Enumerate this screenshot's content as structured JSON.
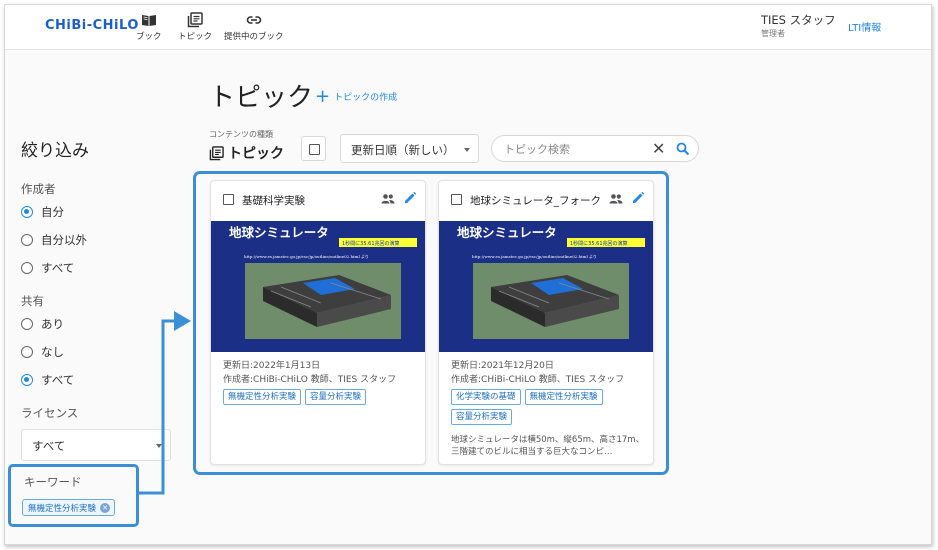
{
  "app": {
    "logo": "CHiBi-CHiLO",
    "nav": [
      {
        "label": "ブック",
        "icon": "book-icon"
      },
      {
        "label": "トピック",
        "icon": "topic-icon"
      },
      {
        "label": "提供中のブック",
        "icon": "link-icon"
      }
    ],
    "user": {
      "name": "TIES スタッフ",
      "role": "管理者"
    },
    "lti_link": "LTI情報"
  },
  "page": {
    "title": "トピック",
    "create_label": "トピックの作成"
  },
  "filter": {
    "title": "絞り込み",
    "author": {
      "label": "作成者",
      "options": [
        "自分",
        "自分以外",
        "すべて"
      ],
      "selected": "自分"
    },
    "share": {
      "label": "共有",
      "options": [
        "あり",
        "なし",
        "すべて"
      ],
      "selected": "すべて"
    },
    "license": {
      "label": "ライセンス",
      "value": "すべて"
    },
    "keyword": {
      "label": "キーワード",
      "chip": "無機定性分析実験"
    }
  },
  "toolbar": {
    "content_type_label": "コンテンツの種類",
    "content_type_value": "トピック",
    "sort_value": "更新日順（新しい）",
    "search_placeholder": "トピック検索",
    "search_value": ""
  },
  "cards": [
    {
      "title": "基礎科学実験",
      "thumbnail": {
        "heading": "地球シミュレータ",
        "caption": "1秒間に35.61兆回の演算",
        "url": "http://www.es.jamstec.go.jp/esc/jp/outline/outline02.html より"
      },
      "updated": "更新日:2022年1月13日",
      "author": "作成者:CHiBi-CHiLO 教師、TIES スタッフ",
      "tags": [
        "無機定性分析実験",
        "容量分析実験"
      ],
      "description": ""
    },
    {
      "title": "地球シミュレータ_フォーク",
      "thumbnail": {
        "heading": "地球シミュレータ",
        "caption": "1秒間に35.61兆回の演算",
        "url": "http://www.es.jamstec.go.jp/esc/jp/outline/outline02.html より"
      },
      "updated": "更新日:2021年12月20日",
      "author": "作成者:CHiBi-CHiLO 教師、TIES スタッフ",
      "tags": [
        "化学実験の基礎",
        "無機定性分析実験",
        "容量分析実験"
      ],
      "description": "地球シミュレータは横50m、縦65m、高さ17m、三階建てのビルに相当する巨大なコンピ…"
    }
  ],
  "colors": {
    "accent": "#1e88e5",
    "highlight_border": "#3a8fd6",
    "thumbnail_bg": "#1b2f86",
    "thumbnail_heading": "#ffffff",
    "thumbnail_caption_bg": "#ffff33"
  }
}
